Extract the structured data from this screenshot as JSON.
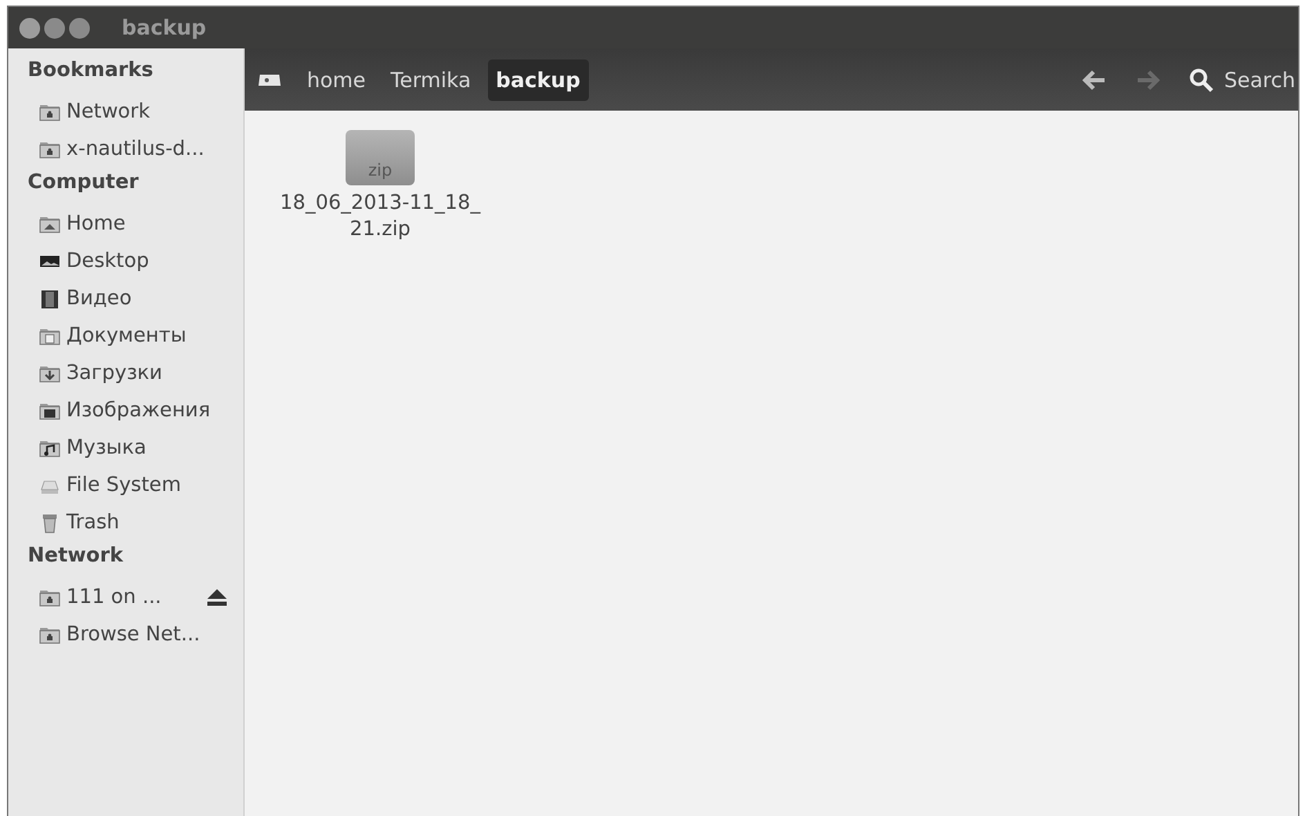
{
  "window": {
    "title": "backup"
  },
  "sidebar": {
    "sections": [
      {
        "heading": "Bookmarks",
        "items": [
          {
            "label": "Network",
            "kind": "network",
            "ejectable": false
          },
          {
            "label": "x-nautilus-d...",
            "kind": "network",
            "ejectable": false
          }
        ]
      },
      {
        "heading": "Computer",
        "items": [
          {
            "label": "Home",
            "kind": "home",
            "ejectable": false
          },
          {
            "label": "Desktop",
            "kind": "desktop",
            "ejectable": false
          },
          {
            "label": "Видео",
            "kind": "video",
            "ejectable": false
          },
          {
            "label": "Документы",
            "kind": "documents",
            "ejectable": false
          },
          {
            "label": "Загрузки",
            "kind": "downloads",
            "ejectable": false
          },
          {
            "label": "Изображения",
            "kind": "pictures",
            "ejectable": false
          },
          {
            "label": "Музыка",
            "kind": "music",
            "ejectable": false
          },
          {
            "label": "File System",
            "kind": "drive",
            "ejectable": false
          },
          {
            "label": "Trash",
            "kind": "trash",
            "ejectable": false
          }
        ]
      },
      {
        "heading": "Network",
        "items": [
          {
            "label": "111 on ...",
            "kind": "network",
            "ejectable": true
          },
          {
            "label": "Browse Net...",
            "kind": "network",
            "ejectable": false
          }
        ]
      }
    ]
  },
  "path": [
    {
      "label": "home",
      "selected": false
    },
    {
      "label": "Termika",
      "selected": false
    },
    {
      "label": "backup",
      "selected": true
    }
  ],
  "nav": {
    "back_disabled": false,
    "forward_disabled": true
  },
  "search": {
    "label": "Search"
  },
  "files": [
    {
      "name": "18_06_2013-11_18_\n21.zip",
      "badge": "zip"
    }
  ]
}
